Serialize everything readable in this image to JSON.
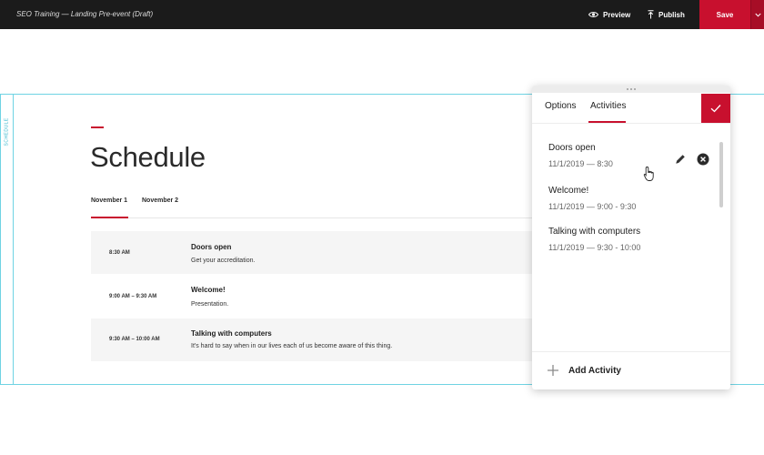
{
  "topbar": {
    "doc_title": "SEO Training — Landing Pre-event (Draft)",
    "preview_label": "Preview",
    "publish_label": "Publish",
    "save_label": "Save"
  },
  "section": {
    "label": "SCHEDULE",
    "title": "Schedule",
    "day_tabs": [
      "November 1",
      "November 2"
    ],
    "active_day": "November 1",
    "agenda": [
      {
        "time": "8:30 AM",
        "title": "Doors open",
        "description": "Get your accreditation."
      },
      {
        "time": "9:00 AM – 9:30 AM",
        "title": "Welcome!",
        "description": "Presentation."
      },
      {
        "time": "9:30 AM – 10:00 AM",
        "title": "Talking with computers",
        "description": "It's hard to say when in our lives each of us become aware of this thing."
      }
    ]
  },
  "panel": {
    "tabs": [
      "Options",
      "Activities"
    ],
    "active_tab": "Activities",
    "activities": [
      {
        "name": "Doors open",
        "date": "11/1/2019",
        "time": "8:30"
      },
      {
        "name": "Welcome!",
        "date": "11/1/2019",
        "time": "9:00 - 9:30"
      },
      {
        "name": "Talking with computers",
        "date": "11/1/2019",
        "time": "9:30 - 10:00"
      }
    ],
    "add_label": "Add Activity"
  },
  "icons": {
    "preview": "eye-icon",
    "publish": "upload-arrow-icon",
    "save_dropdown": "chevron-down-icon",
    "confirm": "checkmark-icon",
    "edit": "pencil-icon",
    "remove": "close-circle-icon",
    "add": "plus-icon",
    "cursor": "hand-pointer-icon"
  },
  "colors": {
    "accent": "#c8102e",
    "topbar": "#1b1b1b",
    "section_outline": "#6fd3e3"
  }
}
